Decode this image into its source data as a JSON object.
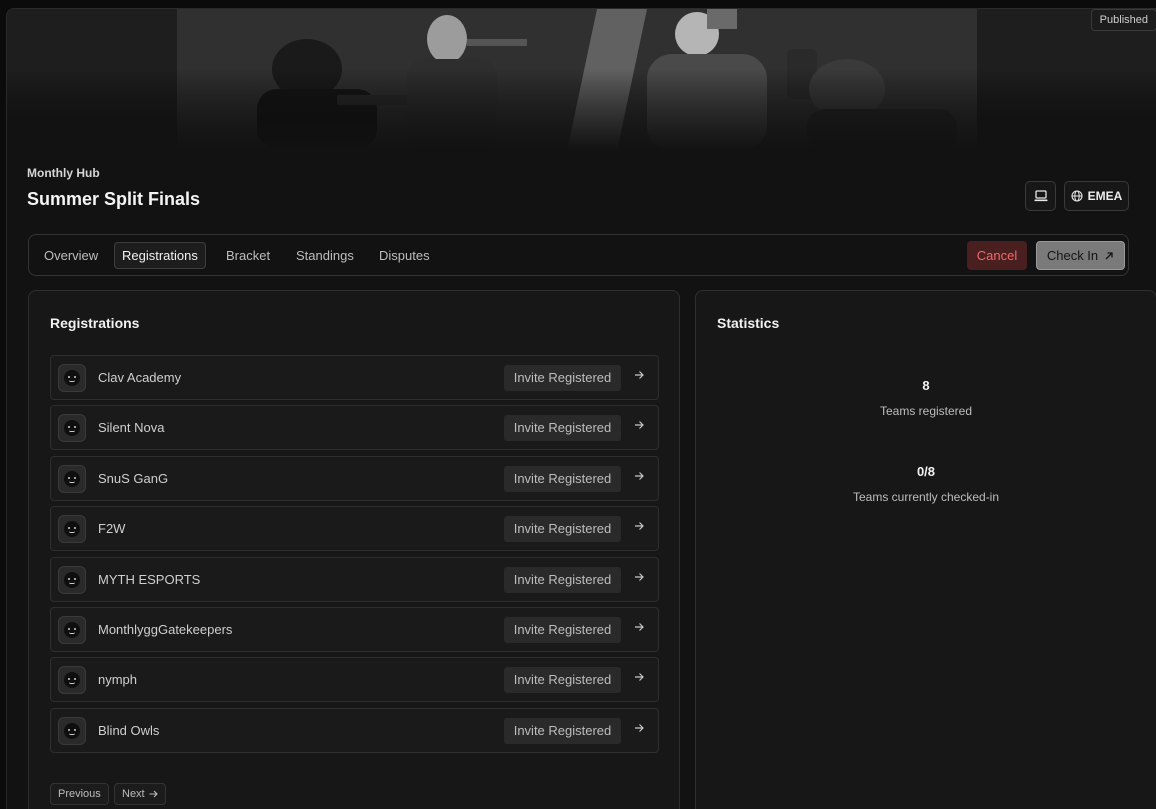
{
  "header": {
    "status_badge": "Published",
    "hub_label": "Monthly Hub",
    "title": "Summer Split Finals",
    "platform_icon": "laptop-icon",
    "region_icon": "globe-icon",
    "region_label": "EMEA"
  },
  "tabs": [
    {
      "label": "Overview",
      "active": false
    },
    {
      "label": "Registrations",
      "active": true
    },
    {
      "label": "Bracket",
      "active": false
    },
    {
      "label": "Standings",
      "active": false
    },
    {
      "label": "Disputes",
      "active": false
    }
  ],
  "actions": {
    "cancel_label": "Cancel",
    "checkin_label": "Check In",
    "checkin_icon": "arrow-up-right-icon"
  },
  "registrations": {
    "title": "Registrations",
    "items": [
      {
        "team": "Clav Academy",
        "status": "Invite Registered"
      },
      {
        "team": "Silent Nova",
        "status": "Invite Registered"
      },
      {
        "team": "SnuS GanG",
        "status": "Invite Registered"
      },
      {
        "team": "F2W",
        "status": "Invite Registered"
      },
      {
        "team": "MYTH ESPORTS",
        "status": "Invite Registered"
      },
      {
        "team": "MonthlyggGatekeepers",
        "status": "Invite Registered"
      },
      {
        "team": "nymph",
        "status": "Invite Registered"
      },
      {
        "team": "Blind Owls",
        "status": "Invite Registered"
      }
    ],
    "pagination": {
      "previous_label": "Previous",
      "next_label": "Next"
    }
  },
  "statistics": {
    "title": "Statistics",
    "teams_registered_value": "8",
    "teams_registered_label": "Teams registered",
    "checked_in_value": "0/8",
    "checked_in_label": "Teams currently checked-in"
  },
  "colors": {
    "background": "#121212",
    "cancel_bg": "#4a1f1f",
    "cancel_text": "#ef6a6a",
    "checkin_bg": "#7a7a7a"
  }
}
